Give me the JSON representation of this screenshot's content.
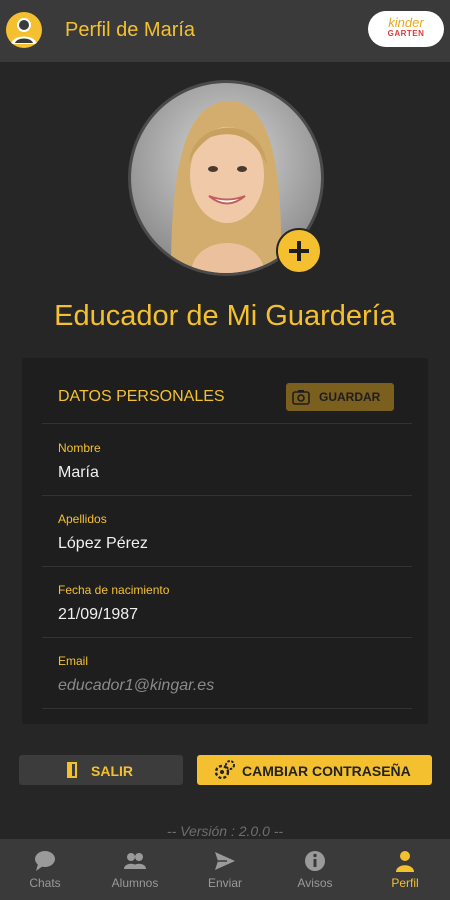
{
  "header": {
    "title": "Perfil de María",
    "brand": {
      "top": "kinder",
      "bottom": "GARTEN"
    }
  },
  "profile": {
    "role_title": "Educador de Mi Guardería"
  },
  "card": {
    "title": "DATOS PERSONALES",
    "save_label": "GUARDAR",
    "fields": [
      {
        "label": "Nombre",
        "value": "María"
      },
      {
        "label": "Apellidos",
        "value": "López Pérez"
      },
      {
        "label": "Fecha de nacimiento",
        "value": "21/09/1987"
      },
      {
        "label": "Email",
        "value": "educador1@kingar.es"
      }
    ]
  },
  "actions": {
    "logout_label": "SALIR",
    "change_password_label": "CAMBIAR CONTRASEÑA"
  },
  "version": "-- Versión : 2.0.0 --",
  "tabs": [
    {
      "label": "Chats",
      "icon": "chat-icon",
      "active": false
    },
    {
      "label": "Alumnos",
      "icon": "students-icon",
      "active": false
    },
    {
      "label": "Enviar",
      "icon": "send-icon",
      "active": false
    },
    {
      "label": "Avisos",
      "icon": "info-icon",
      "active": false
    },
    {
      "label": "Perfil",
      "icon": "person-icon",
      "active": true
    }
  ],
  "colors": {
    "accent": "#f5c030",
    "background": "#262626",
    "bar": "#3a3a3a",
    "card": "#1e1e1e"
  }
}
